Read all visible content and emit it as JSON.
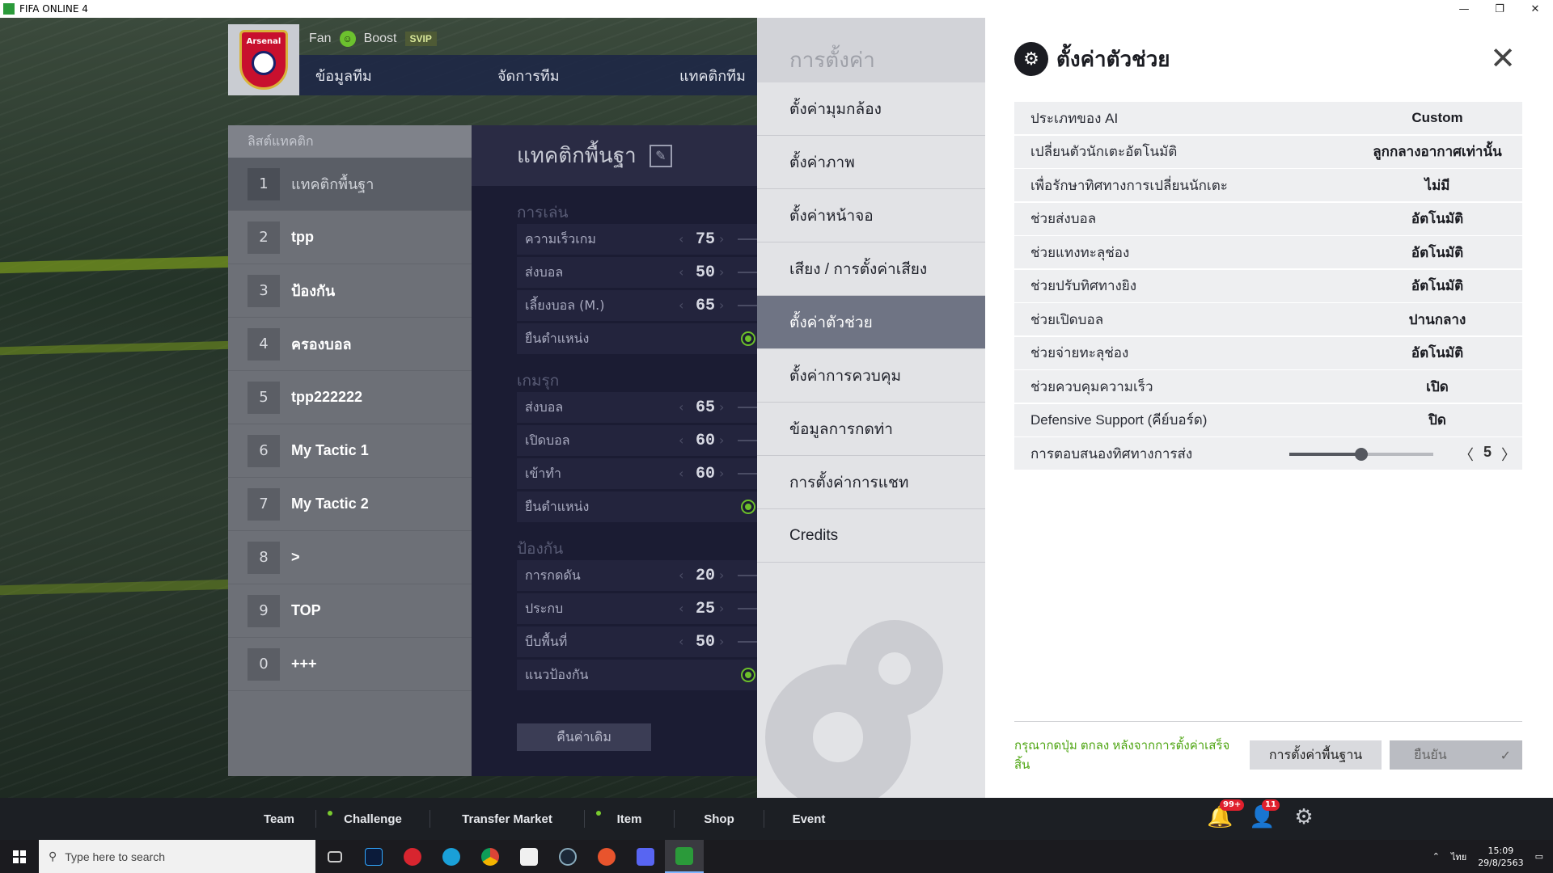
{
  "window": {
    "title": "FIFA ONLINE 4",
    "minimize": "—",
    "restore": "❐",
    "close": "✕"
  },
  "club": {
    "crest_text": "Arsenal",
    "fan_label": "Fan",
    "boost_label": "Boost",
    "svip_label": "SVIP",
    "tabs": [
      "ข้อมูลทีม",
      "จัดการทีม",
      "แทคติกทีม"
    ]
  },
  "tactic_list": {
    "header": "ลิสต์แทคติก",
    "items": [
      {
        "num": "1",
        "label": "แทคติกพื้นฐา",
        "active": true
      },
      {
        "num": "2",
        "label": "tpp"
      },
      {
        "num": "3",
        "label": "ป้องกัน"
      },
      {
        "num": "4",
        "label": "ครองบอล"
      },
      {
        "num": "5",
        "label": "tpp222222"
      },
      {
        "num": "6",
        "label": "My Tactic 1"
      },
      {
        "num": "7",
        "label": "My Tactic 2"
      },
      {
        "num": "8",
        "label": ">"
      },
      {
        "num": "9",
        "label": "TOP"
      },
      {
        "num": "0",
        "label": "+++"
      }
    ]
  },
  "tactic_detail": {
    "title": "แทคติกพื้นฐา",
    "sections": [
      {
        "name": "การเล่น",
        "rows": [
          {
            "label": "ความเร็วเกม",
            "value": "75"
          },
          {
            "label": "ส่งบอล",
            "value": "50"
          },
          {
            "label": "เลี้ยงบอล (M.)",
            "value": "65"
          },
          {
            "label": "ยืนตำแหน่ง",
            "toggle": true
          }
        ]
      },
      {
        "name": "เกมรุก",
        "rows": [
          {
            "label": "ส่งบอล",
            "value": "65"
          },
          {
            "label": "เปิดบอล",
            "value": "60"
          },
          {
            "label": "เข้าทำ",
            "value": "60"
          },
          {
            "label": "ยืนตำแหน่ง",
            "toggle": true
          }
        ]
      },
      {
        "name": "ป้องกัน",
        "rows": [
          {
            "label": "การกดดัน",
            "value": "20"
          },
          {
            "label": "ประกบ",
            "value": "25"
          },
          {
            "label": "บีบพื้นที่",
            "value": "50"
          },
          {
            "label": "แนวป้องกัน",
            "toggle": true
          }
        ]
      }
    ],
    "reset_label": "คืนค่าเดิม"
  },
  "settings_menu": {
    "title": "การตั้งค่า",
    "items": [
      {
        "label": "ตั้งค่ามุมกล้อง"
      },
      {
        "label": "ตั้งค่าภาพ"
      },
      {
        "label": "ตั้งค่าหน้าจอ"
      },
      {
        "label": "เสียง / การตั้งค่าเสียง"
      },
      {
        "label": "ตั้งค่าตัวช่วย",
        "active": true
      },
      {
        "label": "ตั้งค่าการควบคุม"
      },
      {
        "label": "ข้อมูลการกดท่า"
      },
      {
        "label": "การตั้งค่าการแชท"
      },
      {
        "label": "Credits"
      }
    ]
  },
  "assist_panel": {
    "title": "ตั้งค่าตัวช่วย",
    "rows": [
      {
        "label": "ประเภทของ AI",
        "value": "Custom"
      },
      {
        "label": "เปลี่ยนตัวนักเตะอัตโนมัติ",
        "value": "ลูกกลางอากาศเท่านั้น"
      },
      {
        "label": "เพื่อรักษาทิศทางการเปลี่ยนนักเตะ",
        "value": "ไม่มี"
      },
      {
        "label": "ช่วยส่งบอล",
        "value": "อัตโนมัติ"
      },
      {
        "label": "ช่วยแทงทะลุช่อง",
        "value": "อัตโนมัติ"
      },
      {
        "label": "ช่วยปรับทิศทางยิง",
        "value": "อัตโนมัติ"
      },
      {
        "label": "ช่วยเปิดบอล",
        "value": "ปานกลาง"
      },
      {
        "label": "ช่วยจ่ายทะลุช่อง",
        "value": "อัตโนมัติ"
      },
      {
        "label": "ช่วยควบคุมความเร็ว",
        "value": "เปิด"
      },
      {
        "label": "Defensive Support (คีย์บอร์ด)",
        "value": "ปิด"
      }
    ],
    "slider_row": {
      "label": "การตอบสนองทิศทางการส่ง",
      "value": "5",
      "fraction": 0.5
    },
    "hint": "กรุณากดปุ่ม ตกลง หลังจากการตั้งค่าเสร็จสิ้น",
    "default_button": "การตั้งค่าพื้นฐาน",
    "confirm_button": "ยืนยัน"
  },
  "bottom_bar": {
    "items": [
      {
        "label": "Team",
        "dot": false
      },
      {
        "label": "Challenge",
        "dot": true
      },
      {
        "label": "Transfer Market",
        "dot": false
      },
      {
        "label": "Item",
        "dot": true
      },
      {
        "label": "Shop",
        "dot": false
      },
      {
        "label": "Event",
        "dot": false
      }
    ],
    "notif_badge": "99+",
    "friend_badge": "11"
  },
  "taskbar": {
    "search_placeholder": "Type here to search",
    "language": "ไทย",
    "time": "15:09",
    "date": "29/8/2563"
  }
}
